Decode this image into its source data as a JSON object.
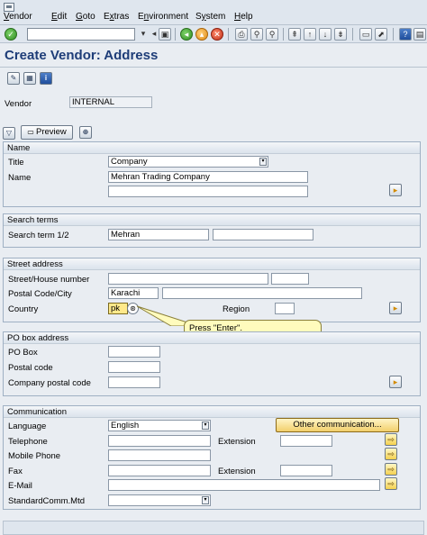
{
  "menu": [
    "Vendor",
    "Edit",
    "Goto",
    "Extras",
    "Environment",
    "System",
    "Help"
  ],
  "menu_underline": [
    "V",
    "E",
    "G",
    "x",
    "n",
    "y",
    "H"
  ],
  "page_title": "Create Vendor: Address",
  "vendor": {
    "label": "Vendor",
    "value": "INTERNAL"
  },
  "preview_label": "Preview",
  "name_group": {
    "title": "Name",
    "title_label": "Title",
    "title_value": "Company",
    "name_label": "Name",
    "name_value": "Mehran Trading Company"
  },
  "search_group": {
    "title": "Search terms",
    "term_label": "Search term 1/2",
    "term1": "Mehran",
    "term2": ""
  },
  "street_group": {
    "title": "Street address",
    "street_label": "Street/House number",
    "postal_label": "Postal Code/City",
    "city_value": "Karachi",
    "country_label": "Country",
    "country_value": "pk",
    "region_label": "Region"
  },
  "pobox_group": {
    "title": "PO box address",
    "pobox_label": "PO Box",
    "postal_label": "Postal code",
    "company_postal_label": "Company postal code"
  },
  "comm_group": {
    "title": "Communication",
    "language_label": "Language",
    "language_value": "English",
    "other_comm_label": "Other communication...",
    "telephone_label": "Telephone",
    "extension_label": "Extension",
    "mobile_label": "Mobile Phone",
    "fax_label": "Fax",
    "fax_extension_label": "Extension",
    "email_label": "E-Mail",
    "stdcomm_label": "StandardComm.Mtd"
  },
  "tooltip_text": "Press \"Enter\"."
}
